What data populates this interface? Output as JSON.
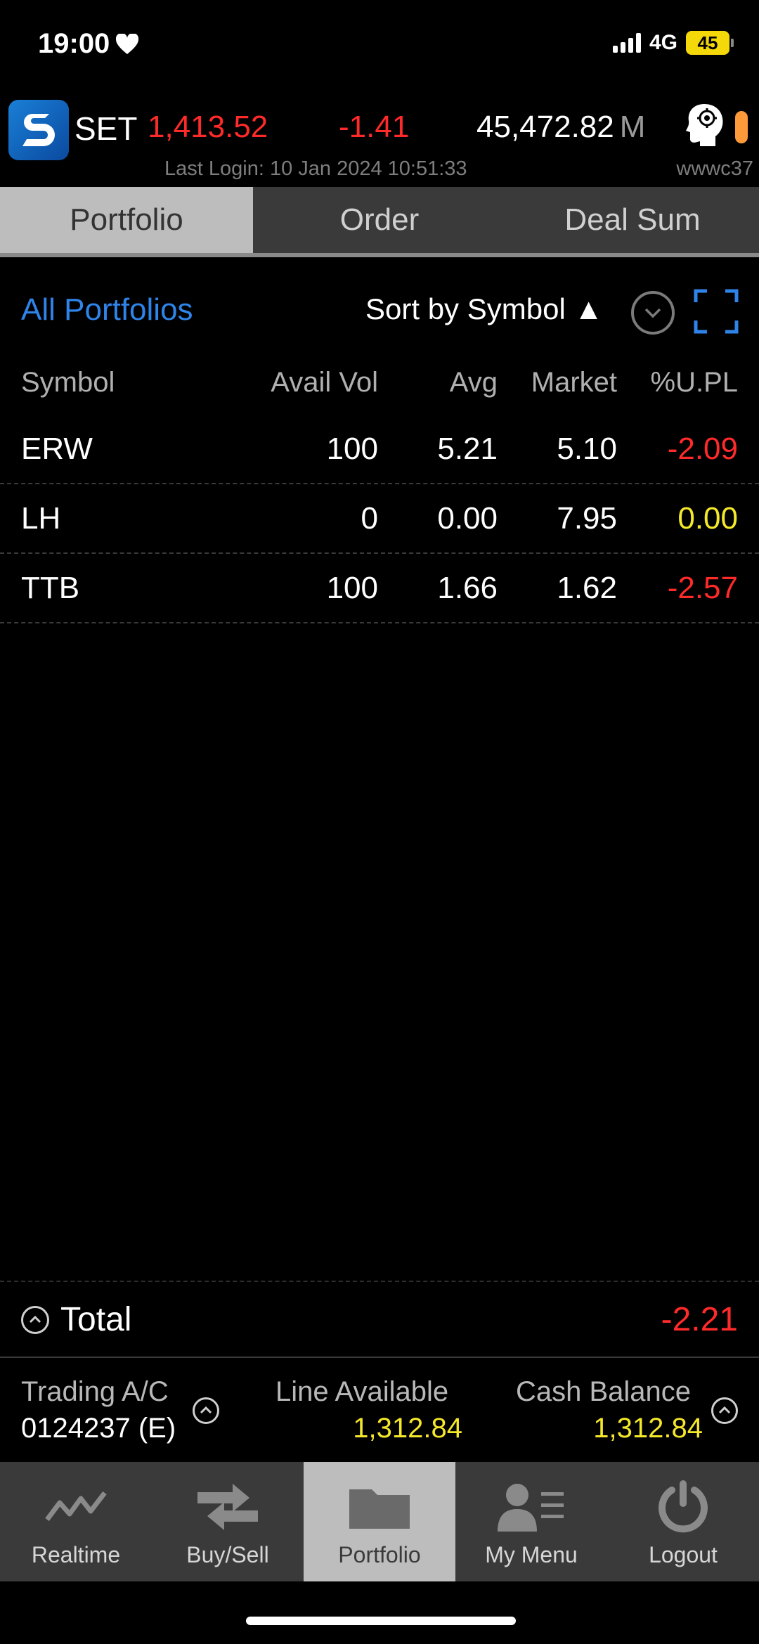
{
  "status_bar": {
    "time": "19:00",
    "network": "4G",
    "battery": "45"
  },
  "market": {
    "index_name": "SET",
    "index_value": "1,413.52",
    "index_change": "-1.41",
    "volume": "45,472.82",
    "volume_unit": "M",
    "last_login": "Last Login: 10 Jan 2024 10:51:33",
    "user_code": "wwwc37"
  },
  "tabs": [
    {
      "label": "Portfolio",
      "active": true
    },
    {
      "label": "Order",
      "active": false
    },
    {
      "label": "Deal Sum",
      "active": false
    }
  ],
  "toolbar": {
    "portfolio_filter": "All Portfolios",
    "sort_label": "Sort by Symbol",
    "sort_direction_glyph": "▲"
  },
  "table": {
    "headers": {
      "symbol": "Symbol",
      "avail_vol": "Avail Vol",
      "avg": "Avg",
      "market": "Market",
      "upl": "%U.PL"
    },
    "rows": [
      {
        "symbol": "ERW",
        "avail_vol": "100",
        "avg": "5.21",
        "market": "5.10",
        "upl": "-2.09",
        "upl_state": "neg"
      },
      {
        "symbol": "LH",
        "avail_vol": "0",
        "avg": "0.00",
        "market": "7.95",
        "upl": "0.00",
        "upl_state": "zero"
      },
      {
        "symbol": "TTB",
        "avail_vol": "100",
        "avg": "1.66",
        "market": "1.62",
        "upl": "-2.57",
        "upl_state": "neg"
      }
    ]
  },
  "total": {
    "label": "Total",
    "value": "-2.21"
  },
  "account": {
    "trading_label": "Trading A/C",
    "trading_no": "0124237 (E)",
    "line_label": "Line Available",
    "line_value": "1,312.84",
    "cash_label": "Cash Balance",
    "cash_value": "1,312.84"
  },
  "nav": [
    {
      "label": "Realtime",
      "icon": "realtime-icon",
      "active": false
    },
    {
      "label": "Buy/Sell",
      "icon": "buy-sell-icon",
      "active": false
    },
    {
      "label": "Portfolio",
      "icon": "portfolio-folder-icon",
      "active": true
    },
    {
      "label": "My Menu",
      "icon": "my-menu-icon",
      "active": false
    },
    {
      "label": "Logout",
      "icon": "logout-icon",
      "active": false
    }
  ],
  "colors": {
    "negative": "#ff2a2a",
    "zero": "#f5e82a",
    "link": "#2f84ea",
    "amount": "#f5e82a"
  }
}
